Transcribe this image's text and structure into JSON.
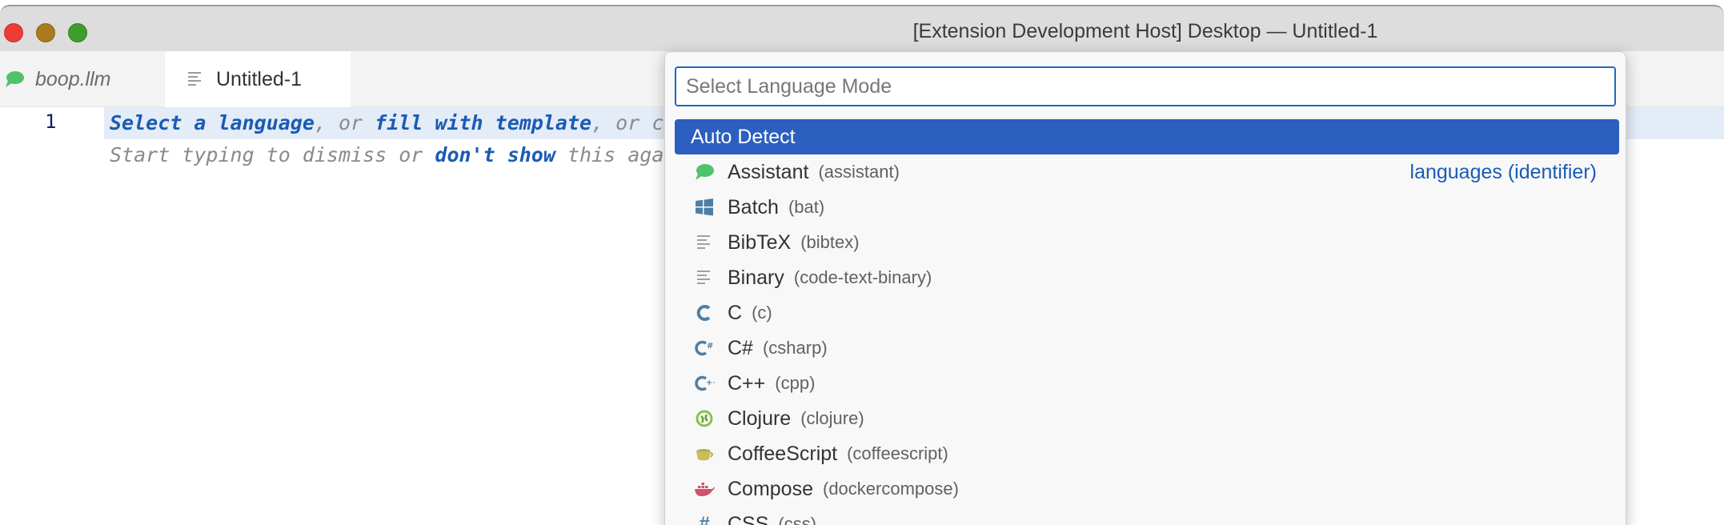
{
  "window": {
    "title": "[Extension Development Host] Desktop — Untitled-1"
  },
  "tabs": [
    {
      "label": "boop.llm",
      "icon": "chat-bubble-icon"
    },
    {
      "label": "Untitled-1",
      "icon": "file-lines-icon"
    }
  ],
  "editor": {
    "line_number": "1",
    "hint_line1": {
      "part1": "Select a language",
      "part2": ", or ",
      "part3": "fill with template",
      "part4": ", or c"
    },
    "hint_line2": {
      "part1": "Start typing to dismiss or ",
      "part2": "don't show",
      "part3": " this aga"
    }
  },
  "quickpick": {
    "placeholder": "Select Language Mode",
    "selected_label": "Auto Detect",
    "items": [
      {
        "label": "Assistant",
        "id": "(assistant)",
        "icon": "chat-bubble-icon",
        "detail": "languages (identifier)"
      },
      {
        "label": "Batch",
        "id": "(bat)",
        "icon": "windows-icon"
      },
      {
        "label": "BibTeX",
        "id": "(bibtex)",
        "icon": "file-lines-icon"
      },
      {
        "label": "Binary",
        "id": "(code-text-binary)",
        "icon": "file-lines-icon"
      },
      {
        "label": "C",
        "id": "(c)",
        "icon": "c-icon"
      },
      {
        "label": "C#",
        "id": "(csharp)",
        "icon": "csharp-icon"
      },
      {
        "label": "C++",
        "id": "(cpp)",
        "icon": "cpp-icon"
      },
      {
        "label": "Clojure",
        "id": "(clojure)",
        "icon": "clojure-icon"
      },
      {
        "label": "CoffeeScript",
        "id": "(coffeescript)",
        "icon": "coffee-icon"
      },
      {
        "label": "Compose",
        "id": "(dockercompose)",
        "icon": "docker-icon"
      },
      {
        "label": "CSS",
        "id": "(css)",
        "icon": "hash-icon"
      }
    ]
  },
  "colors": {
    "accent": "#2c5fbf",
    "link": "#1a5bb5",
    "assistant": "#4fc26b"
  }
}
